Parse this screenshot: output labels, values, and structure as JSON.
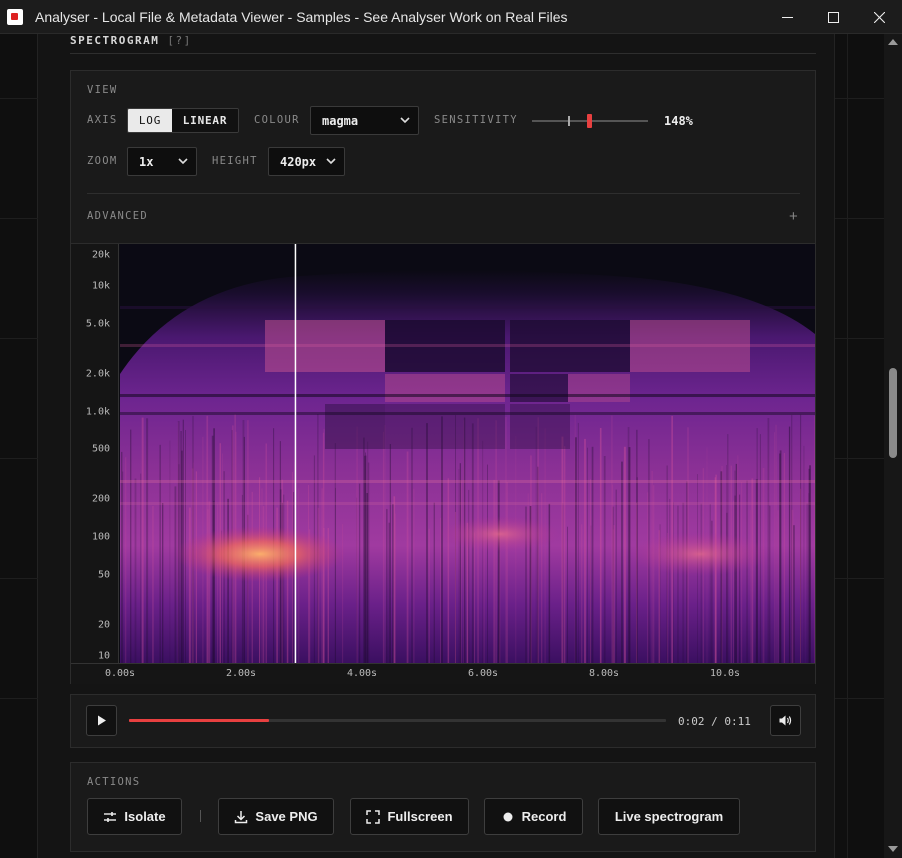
{
  "window": {
    "title": "Analyser - Local File & Metadata Viewer - Samples - See Analyser Work on Real Files",
    "icon": "app-icon"
  },
  "section": {
    "title": "SPECTROGRAM",
    "help": "[?]"
  },
  "view": {
    "label": "VIEW",
    "axis": {
      "label": "AXIS",
      "options": [
        "LOG",
        "LINEAR"
      ],
      "selected": "LOG"
    },
    "colour": {
      "label": "COLOUR",
      "value": "magma"
    },
    "sensitivity": {
      "label": "SENSITIVITY",
      "value_text": "148%",
      "value": 148
    },
    "zoom": {
      "label": "ZOOM",
      "value": "1x"
    },
    "height": {
      "label": "HEIGHT",
      "value": "420px"
    },
    "advanced": {
      "label": "ADVANCED",
      "toggle": "+"
    }
  },
  "spectrogram": {
    "y_ticks": [
      "20k",
      "10k",
      "5.0k",
      "2.0k",
      "1.0k",
      "500",
      "200",
      "100",
      "50",
      "20",
      "10"
    ],
    "x_ticks": [
      "0.00s",
      "2.00s",
      "4.00s",
      "6.00s",
      "8.00s",
      "10.0s"
    ],
    "playhead_seconds": 2.9,
    "colormap": "magma"
  },
  "transport": {
    "current": "0:02",
    "separator": "/",
    "duration": "0:11",
    "progress_fraction": 0.26,
    "play_icon": "play-icon",
    "volume_icon": "volume-icon"
  },
  "actions": {
    "label": "ACTIONS",
    "buttons": [
      {
        "label": "Isolate",
        "icon": "sliders-icon"
      },
      {
        "label": "Save PNG",
        "icon": "download-icon"
      },
      {
        "label": "Fullscreen",
        "icon": "fullscreen-icon"
      },
      {
        "label": "Record",
        "icon": "record-dot-icon"
      },
      {
        "label": "Live spectrogram"
      }
    ]
  }
}
